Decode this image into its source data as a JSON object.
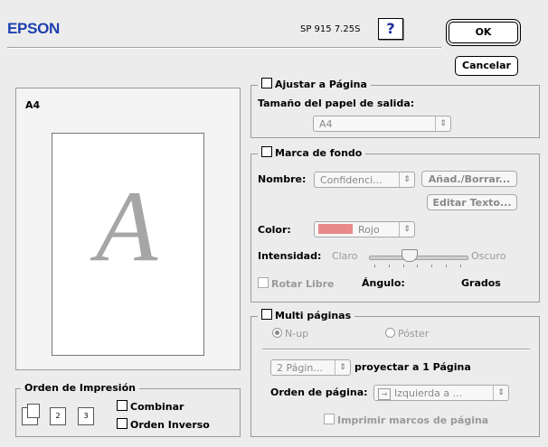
{
  "header": {
    "brand": "EPSON",
    "version": "SP 915 7.25S",
    "help_label": "?",
    "ok_label": "OK",
    "cancel_label": "Cancelar"
  },
  "preview": {
    "paper_label": "A4",
    "glyph": "A"
  },
  "print_order": {
    "title": "Orden de Impresión",
    "combine_label": "Combinar",
    "reverse_label": "Orden Inverso"
  },
  "fit_page": {
    "title": "Ajustar a Página",
    "output_size_label": "Tamaño del papel de salida:",
    "output_size_value": "A4"
  },
  "watermark": {
    "title": "Marca de fondo",
    "name_label": "Nombre:",
    "name_value": "Confidenci...",
    "add_remove_label": "Añad./Borrar...",
    "edit_text_label": "Editar Texto...",
    "color_label": "Color:",
    "color_value": "Rojo",
    "color_hex": "#e88888",
    "intensity_label": "Intensidad:",
    "light_label": "Claro",
    "dark_label": "Oscuro",
    "intensity_value": 0.4,
    "free_rotate_label": "Rotar Libre",
    "angle_label": "Ángulo:",
    "degrees_label": "Grados"
  },
  "multi_page": {
    "title": "Multi páginas",
    "nup_label": "N-up",
    "poster_label": "Póster",
    "pages_value": "2 Págin...",
    "project_label": "proyectar a 1 Página",
    "page_order_label": "Orden de página:",
    "page_order_value": "Izquierda a ...",
    "print_frames_label": "Imprimir marcos de página"
  }
}
